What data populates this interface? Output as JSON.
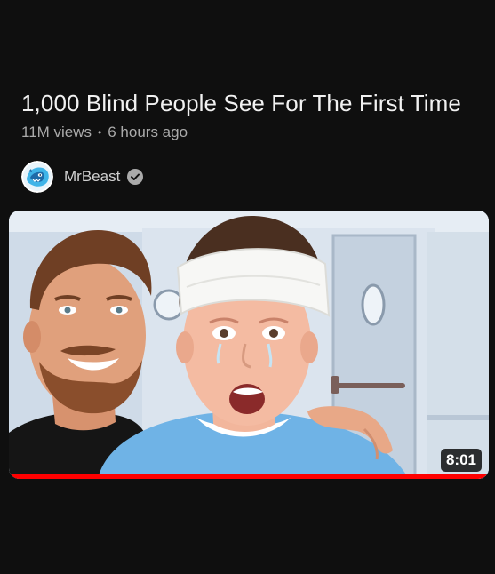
{
  "video": {
    "title": "1,000 Blind People See For The First Time",
    "views": "11M views",
    "separator": "•",
    "age": "6 hours ago",
    "channel": {
      "name": "MrBeast",
      "verified": true,
      "avatar_icon": "mrbeast-panther-avatar"
    },
    "thumbnail": {
      "description_icon": "video-thumbnail",
      "duration": "8:01",
      "watch_progress": 1.0
    }
  },
  "colors": {
    "background": "#0f0f0f",
    "title_text": "#f1f1f1",
    "meta_text": "#aaaaaa",
    "progress": "#ff0000",
    "verified_badge": "#aaaaaa"
  }
}
